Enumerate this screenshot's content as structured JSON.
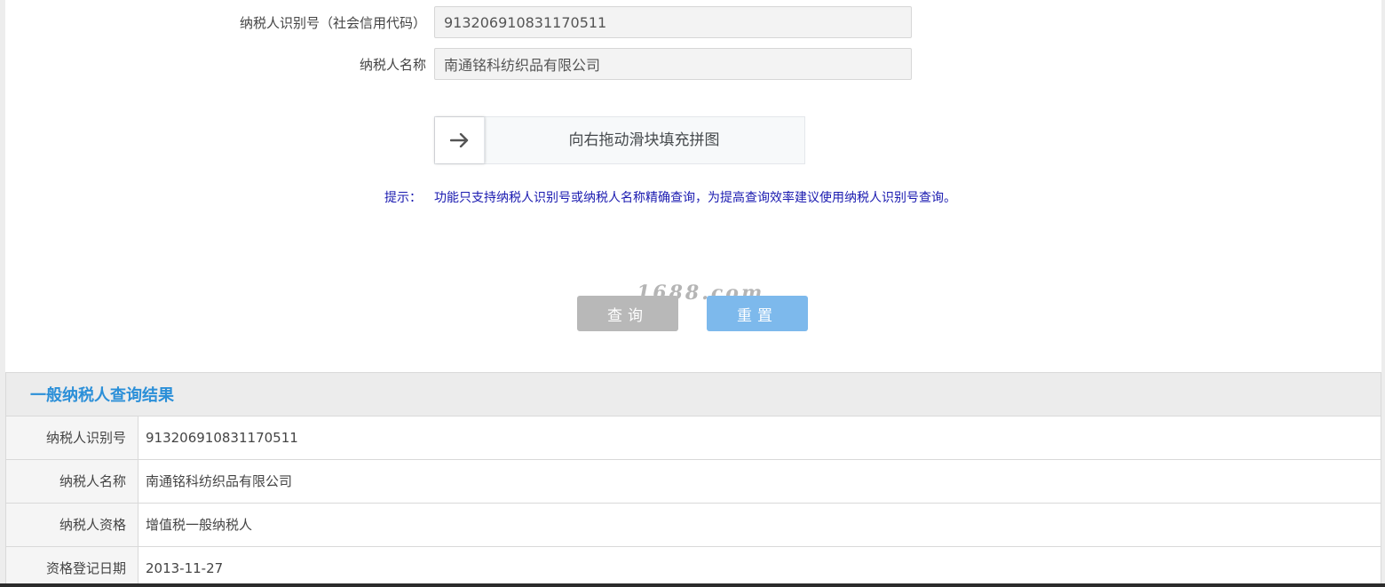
{
  "form": {
    "taxpayer_id_label": "纳税人识别号（社会信用代码）",
    "taxpayer_id_value": "913206910831170511",
    "taxpayer_name_label": "纳税人名称",
    "taxpayer_name_value": "南通铭科纺织品有限公司"
  },
  "slider": {
    "handle_icon": "arrow-right-icon",
    "text": "向右拖动滑块填充拼图"
  },
  "hint": {
    "label": "提示：",
    "text": "功能只支持纳税人识别号或纳税人名称精确查询，为提高查询效率建议使用纳税人识别号查询。"
  },
  "buttons": {
    "query": "查询",
    "reset": "重置"
  },
  "watermark": "1688.com",
  "result": {
    "title": "一般纳税人查询结果",
    "rows": [
      {
        "key": "纳税人识别号",
        "value": "913206910831170511"
      },
      {
        "key": "纳税人名称",
        "value": "南通铭科纺织品有限公司"
      },
      {
        "key": "纳税人资格",
        "value": "增值税一般纳税人"
      },
      {
        "key": "资格登记日期",
        "value": "2013-11-27"
      }
    ]
  },
  "colors": {
    "hint_text": "#1a1ab0",
    "result_title": "#2b8fd8",
    "query_button": "#b8b8b8",
    "reset_button": "#7db9ec"
  }
}
